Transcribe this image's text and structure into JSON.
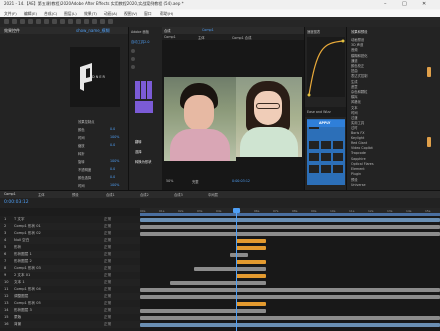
{
  "window": {
    "title": "2021 - 14.【AE】第五课(教程)2020Adobe After Effects 实用教程2020,实战案例教程 (54).aep *",
    "controls": {
      "minimize": "–",
      "maximize": "□",
      "close": "✕"
    }
  },
  "menu": [
    "文件(F)",
    "编辑(E)",
    "合成(C)",
    "图层(L)",
    "效果(T)",
    "动画(A)",
    "视图(V)",
    "窗口",
    "帮助(H)"
  ],
  "left_panel": {
    "tab": "效果控件",
    "sub_tab": "show_name_模糊",
    "logo_text": "DNER",
    "labels": [
      "效果控制点",
      "颜色",
      "时间",
      "缩放",
      "转折",
      "旋转",
      "不透明度",
      "颜色选择",
      "时间"
    ],
    "values": [
      "0.0",
      "100%",
      "0.0",
      "100%",
      "0.0",
      "0.0",
      "100%"
    ]
  },
  "plugin_panel": {
    "tabs": [
      "Adobe 面板",
      "预设"
    ],
    "items": [
      "自动工具2.0",
      "调整",
      "效果"
    ],
    "buttons": [
      "翻转",
      "选择",
      "转换为形状"
    ]
  },
  "viewer": {
    "tabs": [
      "合成",
      "Comp1"
    ],
    "sub_tabs": [
      "Comp1",
      "主体",
      "Comp1 合成"
    ],
    "zoom": "50%",
    "quality": "完整",
    "timecode": "0:00:03:12"
  },
  "right_panel": {
    "graph_label": "速度图表",
    "effects_tab": "效果和预设",
    "effects_list": [
      "动画预设",
      "3D 声道",
      "音频",
      "模糊和锐化",
      "通道",
      "颜色校正",
      "扭曲",
      "表达式控制",
      "生成",
      "遮罩",
      "杂色和颗粒",
      "模拟",
      "风格化",
      "文本",
      "时间",
      "过渡",
      "实用工具",
      "过时",
      "Boris FX",
      "Keylight",
      "Red Giant",
      "Video Copilot",
      "Trapcode",
      "Sapphire",
      "Optical Flares",
      "Element",
      "Plugin",
      "预设",
      "Universe"
    ],
    "preset_header": "Ease and Wizz",
    "apply_label": "APPLY"
  },
  "timeline": {
    "tabs": [
      "Comp1",
      "主体",
      "预设",
      "合成1",
      "合成2",
      "合成3",
      "中间层"
    ],
    "timecode": "0:00:03:12",
    "ruler": [
      "00s",
      "01s",
      "02s",
      "03s",
      "04s",
      "05s",
      "06s",
      "07s",
      "08s",
      "09s",
      "10s",
      "11s",
      "12s",
      "13s",
      "14s",
      "15s"
    ],
    "layers": [
      {
        "num": "1",
        "name": "T 文字",
        "mode": "正常"
      },
      {
        "num": "2",
        "name": "Comp1 形状 01",
        "mode": "正常"
      },
      {
        "num": "3",
        "name": "Comp1 形状 02",
        "mode": "正常"
      },
      {
        "num": "4",
        "name": "Null 空白",
        "mode": "正常"
      },
      {
        "num": "5",
        "name": "形状",
        "mode": "正常"
      },
      {
        "num": "6",
        "name": "形状图层 1",
        "mode": "正常"
      },
      {
        "num": "7",
        "name": "形状图层 2",
        "mode": "正常"
      },
      {
        "num": "8",
        "name": "Comp1 形状 03",
        "mode": "正常"
      },
      {
        "num": "9",
        "name": "2 文本 01",
        "mode": "正常"
      },
      {
        "num": "10",
        "name": "文本 1",
        "mode": "正常"
      },
      {
        "num": "11",
        "name": "Comp1 形状 04",
        "mode": "正常"
      },
      {
        "num": "12",
        "name": "调整图层",
        "mode": "正常"
      },
      {
        "num": "13",
        "name": "Comp1 形状 05",
        "mode": "正常"
      },
      {
        "num": "14",
        "name": "形状图层 3",
        "mode": "正常"
      },
      {
        "num": "15",
        "name": "蒙版",
        "mode": "正常"
      },
      {
        "num": "16",
        "name": "背景",
        "mode": "正常"
      }
    ]
  },
  "colors": {
    "accent": "#4f9ff5",
    "bar_orange": "#e39a2f",
    "bar_gray": "#8c8c8c",
    "bar_blue": "#6a8fb3",
    "apply": "#2f7fd9",
    "yellow": "#e0c040"
  }
}
